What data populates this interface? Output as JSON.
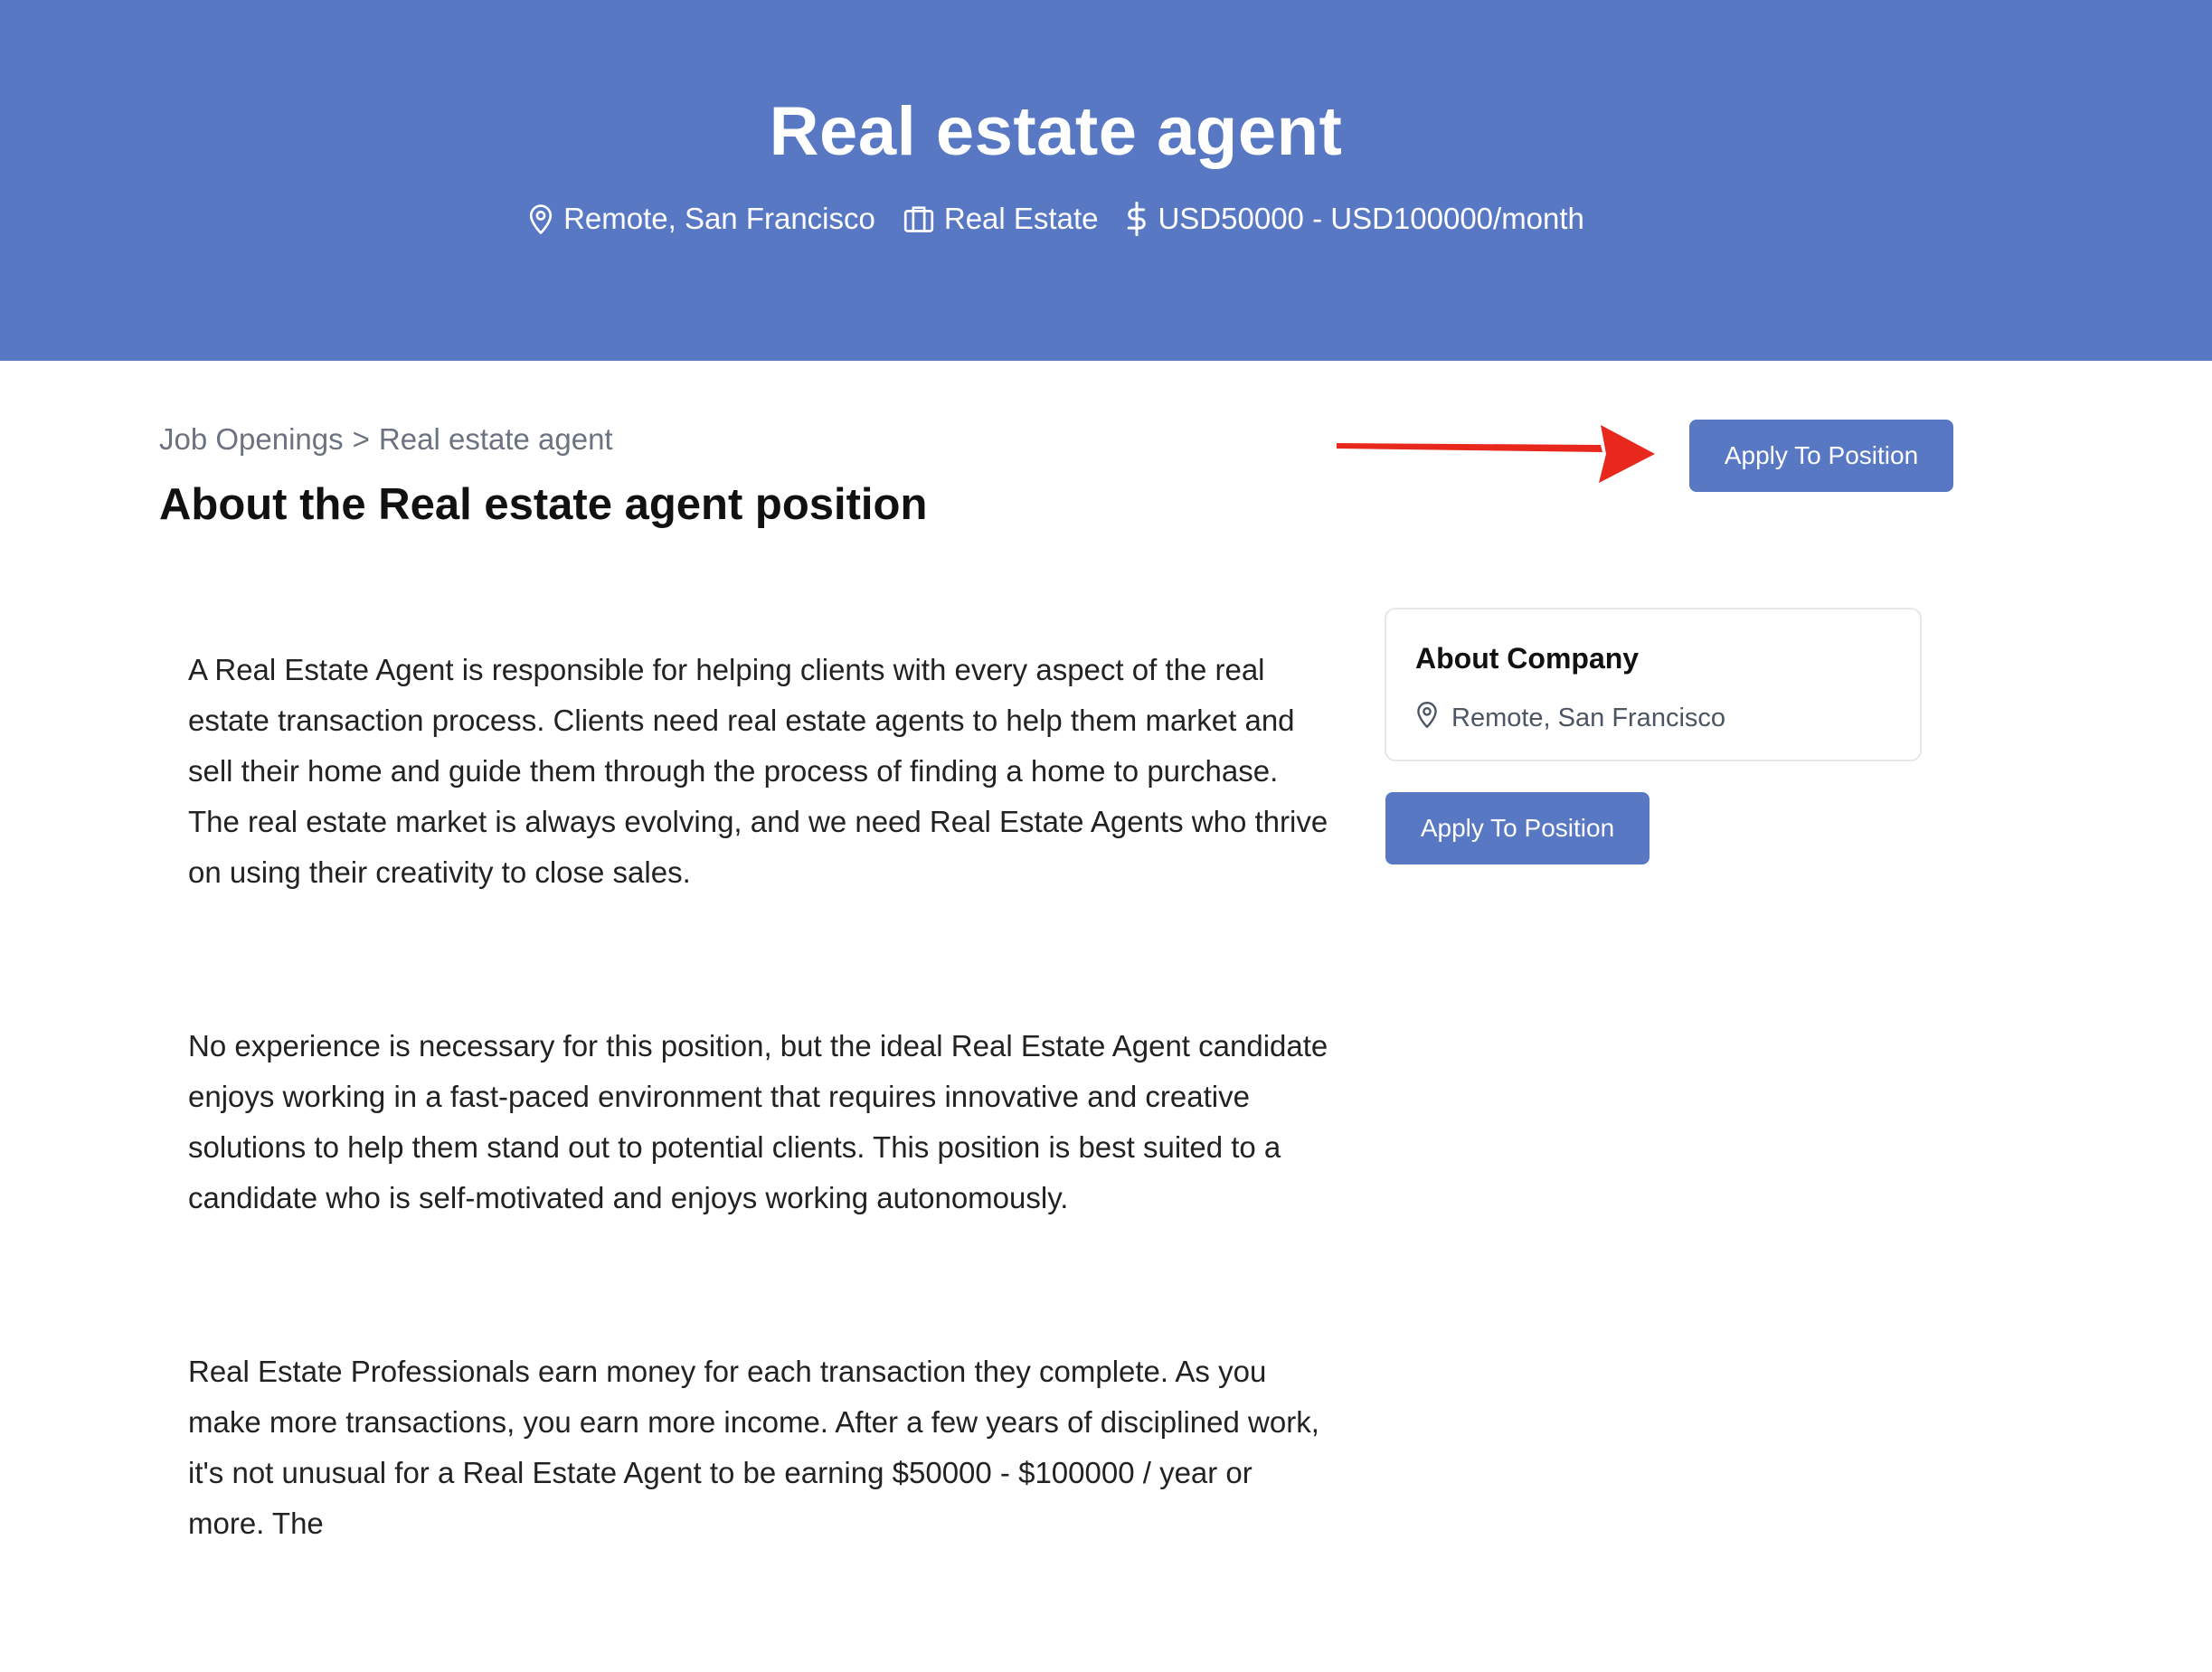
{
  "job": {
    "title": "Real estate agent",
    "location": "Remote, San Francisco",
    "category": "Real Estate",
    "salary": "USD50000 - USD100000/month"
  },
  "breadcrumb": {
    "root": "Job Openings",
    "separator": ">",
    "current": "Real estate agent"
  },
  "heading": "About the Real estate agent position",
  "apply_button_label": "Apply To Position",
  "description": [
    "A Real Estate Agent is responsible for helping clients with every aspect of the real estate transaction process. Clients need real estate agents to help them market and sell their home and guide them through the process of finding a home to purchase. The real estate market is always evolving, and we need Real Estate Agents who thrive on using their creativity to close sales.",
    "No experience is necessary for this position, but the ideal Real Estate Agent candidate enjoys working in a fast-paced environment that requires innovative and creative solutions to help them stand out to potential clients. This position is best suited to a candidate who is self-motivated and enjoys working autonomously.",
    "Real Estate Professionals earn money for each transaction they complete. As you make more transactions, you earn more income. After a few years of disciplined work, it's not unusual for a Real Estate Agent to be earning $50000 - $100000 / year or more. The"
  ],
  "company": {
    "title": "About Company",
    "location": "Remote, San Francisco"
  },
  "icons": {
    "location": "map-pin-icon",
    "category": "briefcase-icon",
    "salary": "dollar-icon",
    "annotation": "red-arrow-icon"
  },
  "colors": {
    "brand": "#5878c4",
    "annotation": "#e8281c"
  }
}
